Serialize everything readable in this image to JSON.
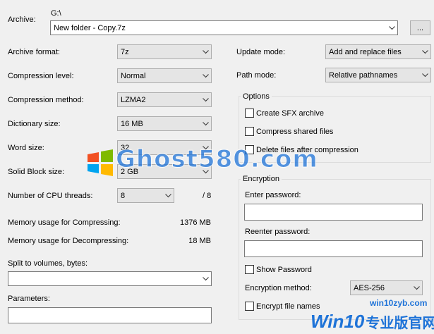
{
  "archive": {
    "label": "Archive:",
    "path": "G:\\",
    "filename": "New folder - Copy.7z",
    "browse_label": "..."
  },
  "left": {
    "archive_format": {
      "label": "Archive format:",
      "value": "7z"
    },
    "compression_level": {
      "label": "Compression level:",
      "value": "Normal"
    },
    "compression_method": {
      "label": "Compression method:",
      "value": "LZMA2"
    },
    "dictionary_size": {
      "label": "Dictionary size:",
      "value": "16 MB"
    },
    "word_size": {
      "label": "Word size:",
      "value": "32"
    },
    "solid_block_size": {
      "label": "Solid Block size:",
      "value": "2 GB"
    },
    "cpu_threads": {
      "label": "Number of CPU threads:",
      "value": "8",
      "max": "/ 8"
    },
    "mem_compress": {
      "label": "Memory usage for Compressing:",
      "value": "1376 MB"
    },
    "mem_decompress": {
      "label": "Memory usage for Decompressing:",
      "value": "18 MB"
    },
    "split_volumes": {
      "label": "Split to volumes, bytes:",
      "value": ""
    },
    "parameters": {
      "label": "Parameters:",
      "value": ""
    }
  },
  "right": {
    "update_mode": {
      "label": "Update mode:",
      "value": "Add and replace files"
    },
    "path_mode": {
      "label": "Path mode:",
      "value": "Relative pathnames"
    },
    "options": {
      "title": "Options",
      "create_sfx": "Create SFX archive",
      "compress_shared": "Compress shared files",
      "delete_after": "Delete files after compression"
    },
    "encryption": {
      "title": "Encryption",
      "enter_password": "Enter password:",
      "reenter_password": "Reenter password:",
      "show_password": "Show Password",
      "method_label": "Encryption method:",
      "method_value": "AES-256",
      "encrypt_names": "Encrypt file names"
    }
  },
  "watermarks": {
    "ghost": "Ghost580.com",
    "site": "win10zyb.com",
    "brand_win": "Win10",
    "brand_cn": "专业版官网"
  },
  "colors": {
    "window_bg": "#f0f0f0",
    "combo_bg": "#e5e5e5",
    "watermark_blue": "#1e73d8"
  }
}
